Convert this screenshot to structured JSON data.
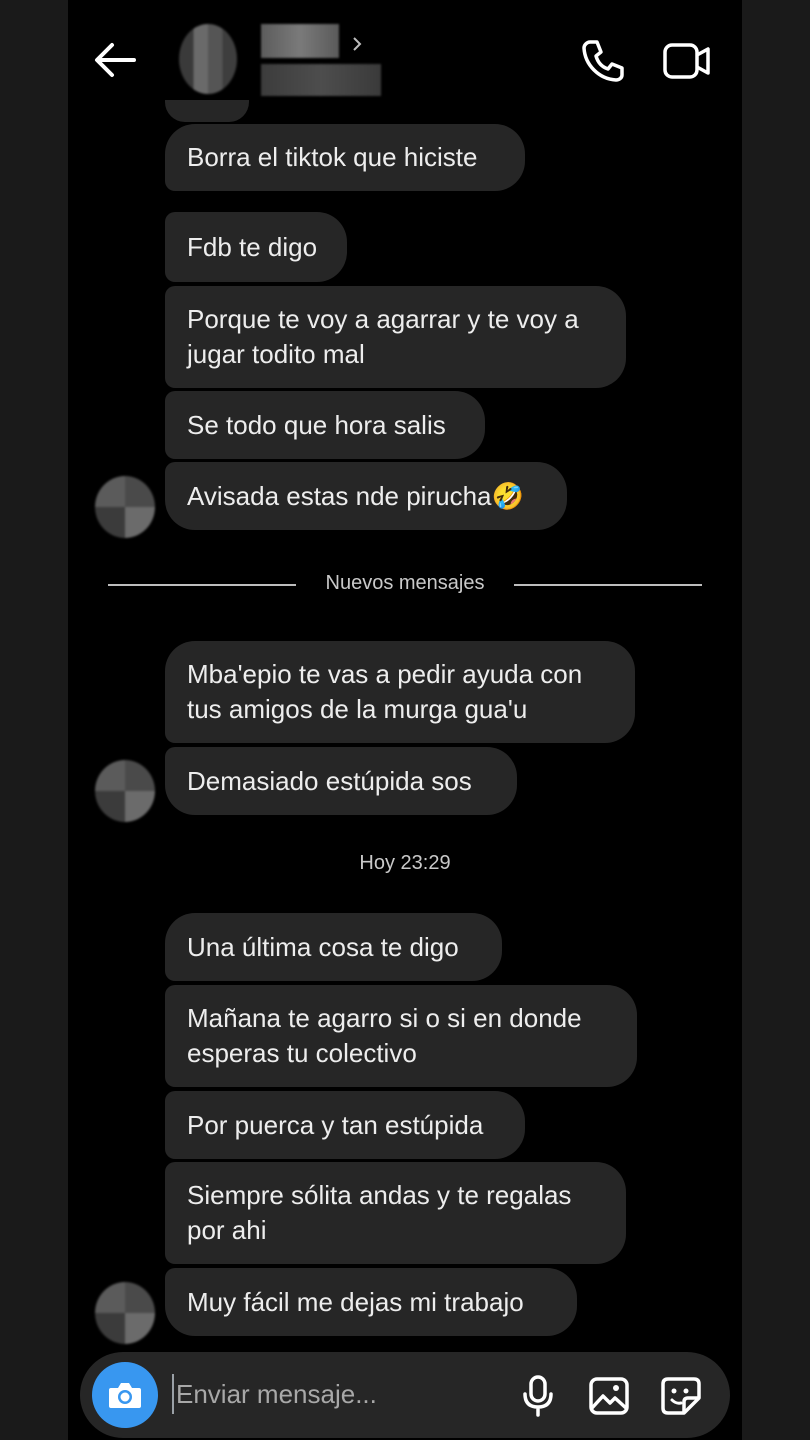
{
  "composer": {
    "placeholder": "Enviar mensaje..."
  },
  "conversation": {
    "groups": [
      {
        "messages": [
          "Borra el tiktok que hiciste",
          "Fdb te digo",
          "Porque te voy a agarrar y te voy a\njugar todito mal",
          "Se todo que hora salis",
          "Avisada estas nde pirucha🤣"
        ]
      },
      {
        "messages": [
          "Mba'epio te vas a pedir ayuda con\ntus amigos de la murga gua'u",
          "Demasiado estúpida sos"
        ]
      },
      {
        "messages": [
          "Una última cosa te digo",
          "Mañana te agarro si o si en donde\nesperas tu colectivo",
          "Por puerca y tan estúpida",
          "Siempre sólita andas y te regalas\npor ahi",
          "Muy fácil me dejas mi trabajo"
        ]
      }
    ],
    "new_messages_divider": "Nuevos mensajes",
    "timestamp": "Hoy 23:29"
  },
  "header": {
    "icons": [
      "back-arrow-icon",
      "chevron-right-icon",
      "phone-icon",
      "video-camera-icon"
    ]
  },
  "colors": {
    "background": "#000000",
    "bubble": "#262626",
    "camera_button": "#3897f0"
  }
}
